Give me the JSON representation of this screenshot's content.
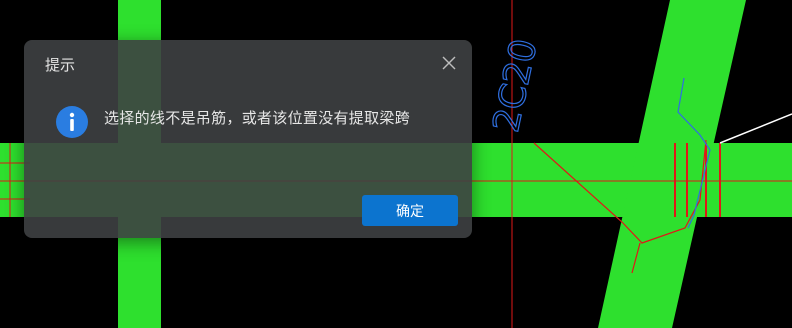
{
  "cad_view": {
    "annotation_text": "2C20",
    "colors": {
      "background": "#000000",
      "beam": "#2ee02e",
      "red_line": "#e01818",
      "annotation": "#2f6fe0",
      "leader": "#ffffff"
    }
  },
  "dialog": {
    "title": "提示",
    "message": "选择的线不是吊筋，或者该位置没有提取梁跨",
    "ok_label": "确定",
    "icons": {
      "close": "close-icon",
      "info": "info-icon"
    },
    "colors": {
      "accent": "#0c74cf",
      "info": "#2a7de1"
    }
  }
}
